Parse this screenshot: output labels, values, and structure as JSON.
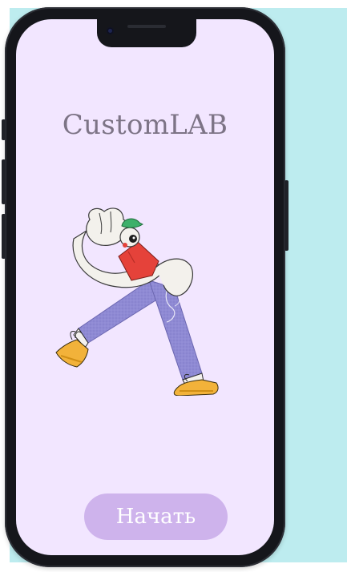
{
  "app": {
    "title": "CustomLAB"
  },
  "illustration": {
    "icon": "walking-person-illustration"
  },
  "actions": {
    "start_label": "Начать"
  },
  "colors": {
    "background": "#bdecef",
    "screen": "#f2e6ff",
    "button": "#ceb3ec",
    "title": "#7d7486"
  }
}
